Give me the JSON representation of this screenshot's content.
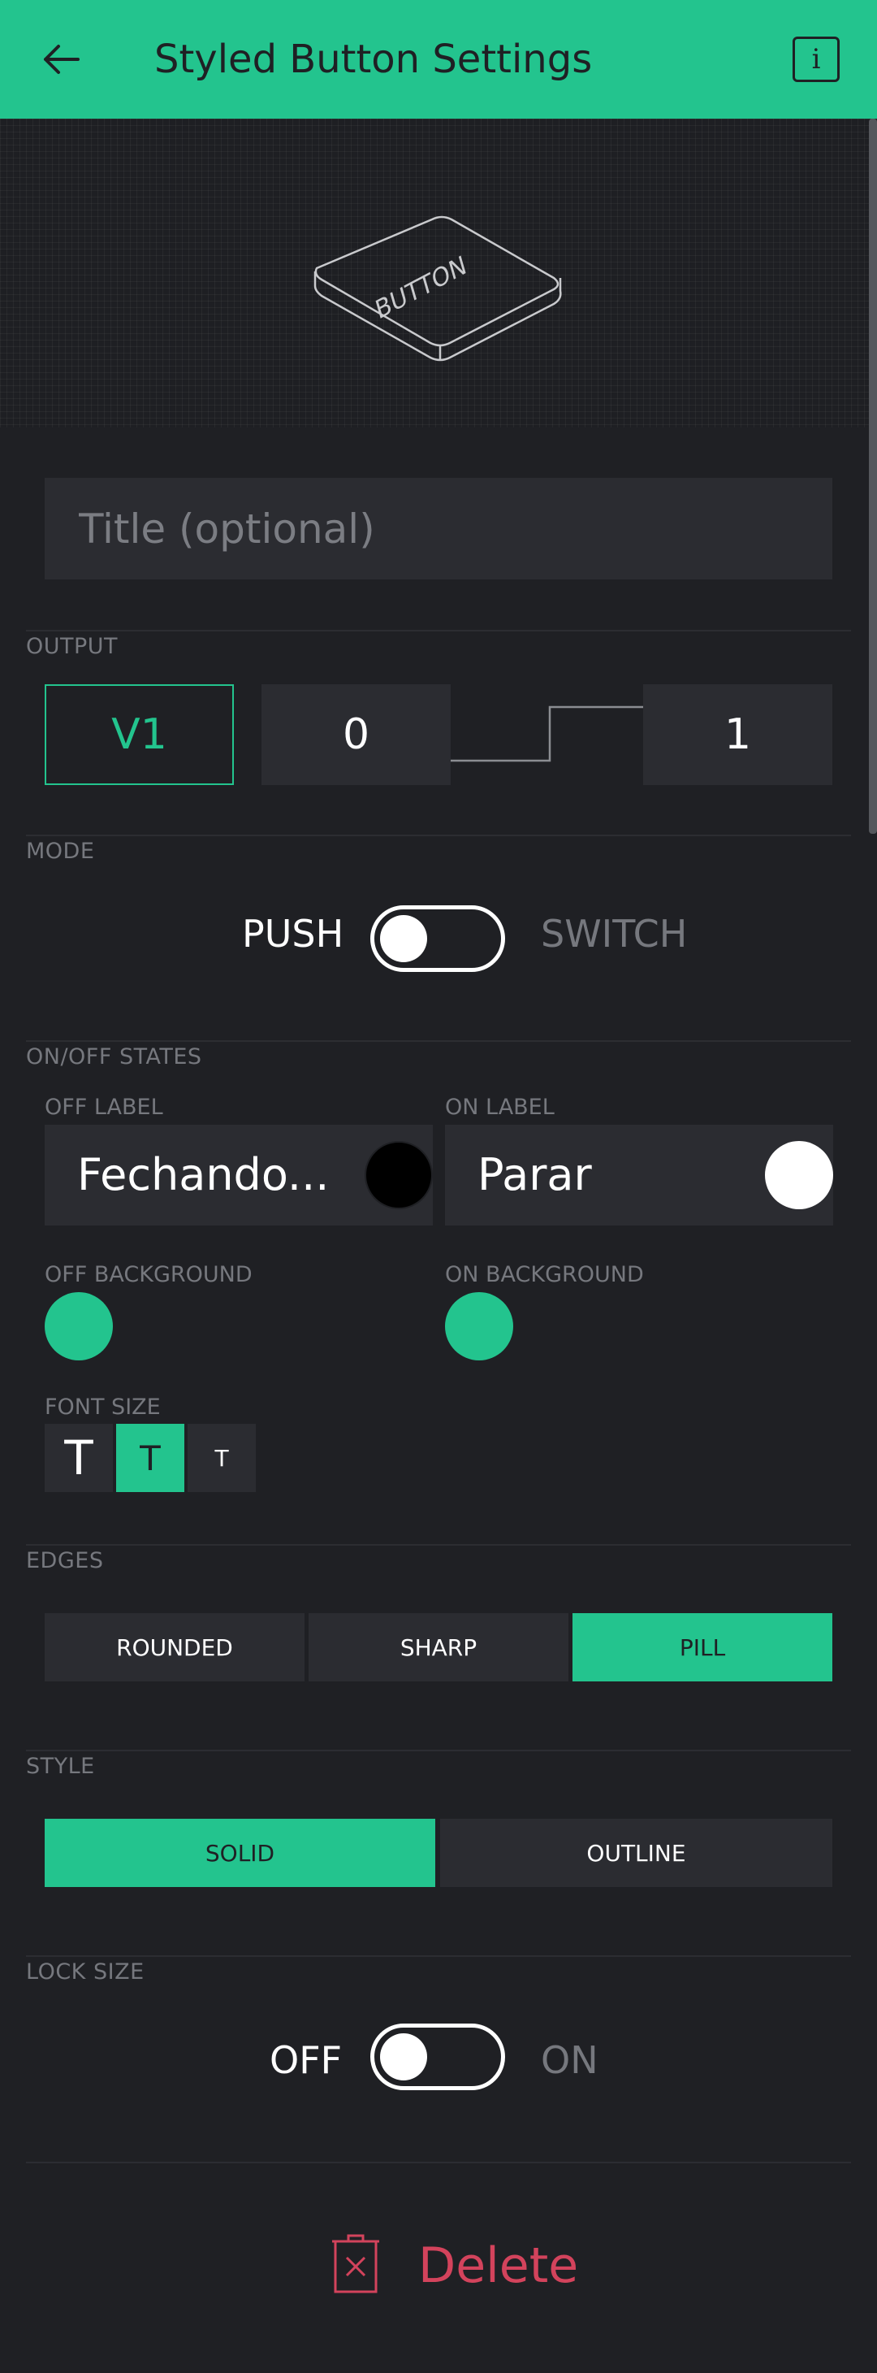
{
  "header": {
    "title": "Styled Button Settings",
    "back_icon": "arrow-left-icon",
    "info_label": "i"
  },
  "preview": {
    "button_text": "BUTTON"
  },
  "title_field": {
    "placeholder": "Title (optional)",
    "value": ""
  },
  "output": {
    "label": "OUTPUT",
    "pin": "V1",
    "low": "0",
    "high": "1"
  },
  "mode": {
    "label": "MODE",
    "left": "PUSH",
    "right": "SWITCH",
    "state": "PUSH"
  },
  "states": {
    "label": "ON/OFF STATES",
    "off_label_title": "OFF LABEL",
    "off_label_value": "Fechando...",
    "off_label_color": "#000000",
    "on_label_title": "ON LABEL",
    "on_label_value": "Parar",
    "on_label_color": "#ffffff",
    "off_background_title": "OFF BACKGROUND",
    "off_background_color": "#23c48e",
    "on_background_title": "ON BACKGROUND",
    "on_background_color": "#23c48e"
  },
  "font_size": {
    "label": "FONT SIZE",
    "options": [
      "T",
      "T",
      "T"
    ],
    "selected_index": 1
  },
  "edges": {
    "label": "EDGES",
    "options": [
      "ROUNDED",
      "SHARP",
      "PILL"
    ],
    "selected": "PILL"
  },
  "style": {
    "label": "STYLE",
    "options": [
      "SOLID",
      "OUTLINE"
    ],
    "selected": "SOLID"
  },
  "lock_size": {
    "label": "LOCK SIZE",
    "left": "OFF",
    "right": "ON",
    "state": "OFF"
  },
  "delete": {
    "label": "Delete"
  },
  "colors": {
    "accent": "#23c48e",
    "background": "#1f2024",
    "field": "#2b2c31",
    "danger": "#d3435c"
  }
}
